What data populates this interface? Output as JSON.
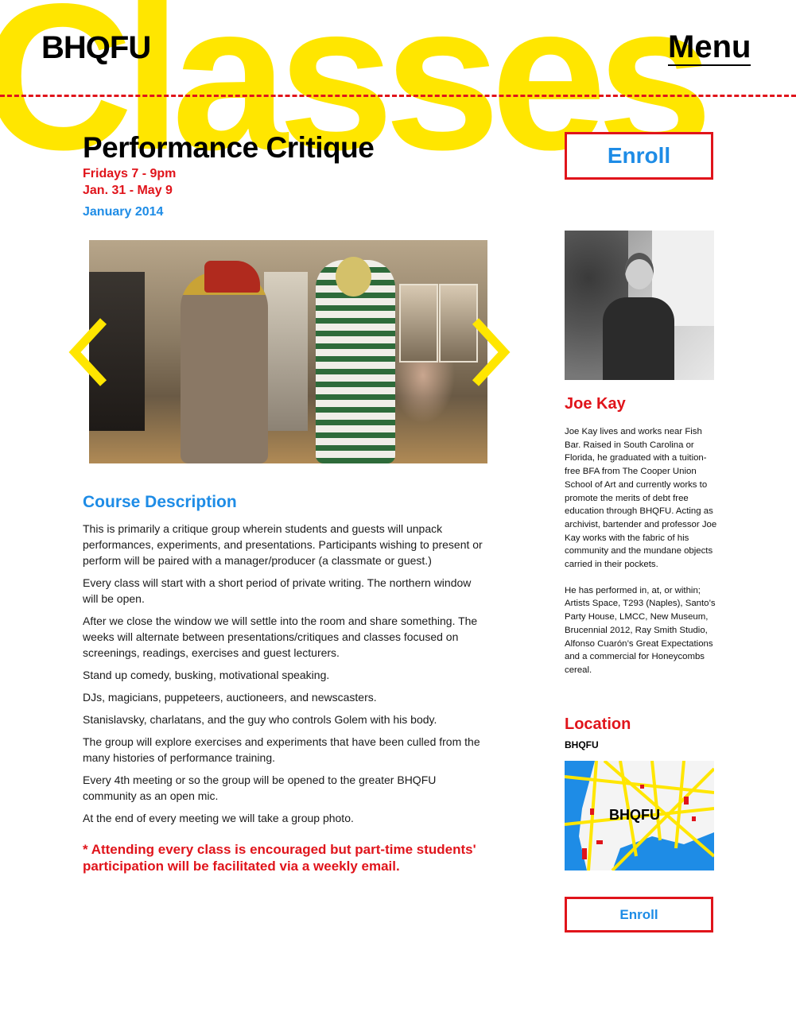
{
  "background_word": "Classes",
  "header": {
    "logo": "BHQFU",
    "menu": "Menu"
  },
  "course": {
    "title": "Performance Critique",
    "schedule_days": "Fridays 7 - 9pm",
    "schedule_dates": "Jan. 31 - May 9",
    "term": "January 2014",
    "enroll_label": "Enroll"
  },
  "slider": {
    "prev_icon": "chevron-left-icon",
    "next_icon": "chevron-right-icon"
  },
  "description": {
    "heading": "Course Description",
    "paragraphs": [
      "This is primarily a critique group wherein students and guests will unpack performances, experiments, and presentations. Participants wishing to present or perform will be paired with a manager/producer (a classmate or guest.)",
      "Every class will start with a short period of private writing. The northern window will be open.",
      "After we close the window we will settle into the room and share something. The weeks will alternate between presentations/critiques and classes focused on screenings, readings, exercises and guest lecturers.",
      "Stand up comedy, busking, motivational speaking.",
      "DJs, magicians, puppeteers, auctioneers,  and newscasters.",
      "Stanislavsky, charlatans, and the guy who controls Golem with his body.",
      "The group will explore exercises and experiments that have been culled from the many histories of performance training.",
      "Every 4th meeting or so the group will be opened to the greater BHQFU community as an open mic.",
      "At the end of every meeting we will take a group photo."
    ],
    "note": "* Attending every class is encouraged but part-time students' participation will be facilitated via a weekly email."
  },
  "instructor": {
    "name": "Joe Kay",
    "bio_1": "Joe Kay lives and works near Fish Bar. Raised in South Carolina or Florida, he graduated with a tuition-free BFA from The Cooper Union School of Art and currently works to promote the merits of debt free education through BHQFU. Acting as archivist, bartender and professor Joe Kay works with the fabric of his community and the mundane objects carried in their pockets.",
    "bio_2": "He has performed in, at, or within; Artists Space, T293 (Naples), Santo’s Party House, LMCC, New Museum, Brucennial 2012, Ray Smith Studio, Alfonso Cuarón’s Great Expectations and a commercial for Honeycombs cereal."
  },
  "location": {
    "heading": "Location",
    "name": "BHQFU",
    "map_label": "BHQFU"
  },
  "enroll_bottom": "Enroll",
  "colors": {
    "accent_red": "#e0141b",
    "accent_blue": "#1e8ce6",
    "brand_yellow": "#ffe600"
  }
}
